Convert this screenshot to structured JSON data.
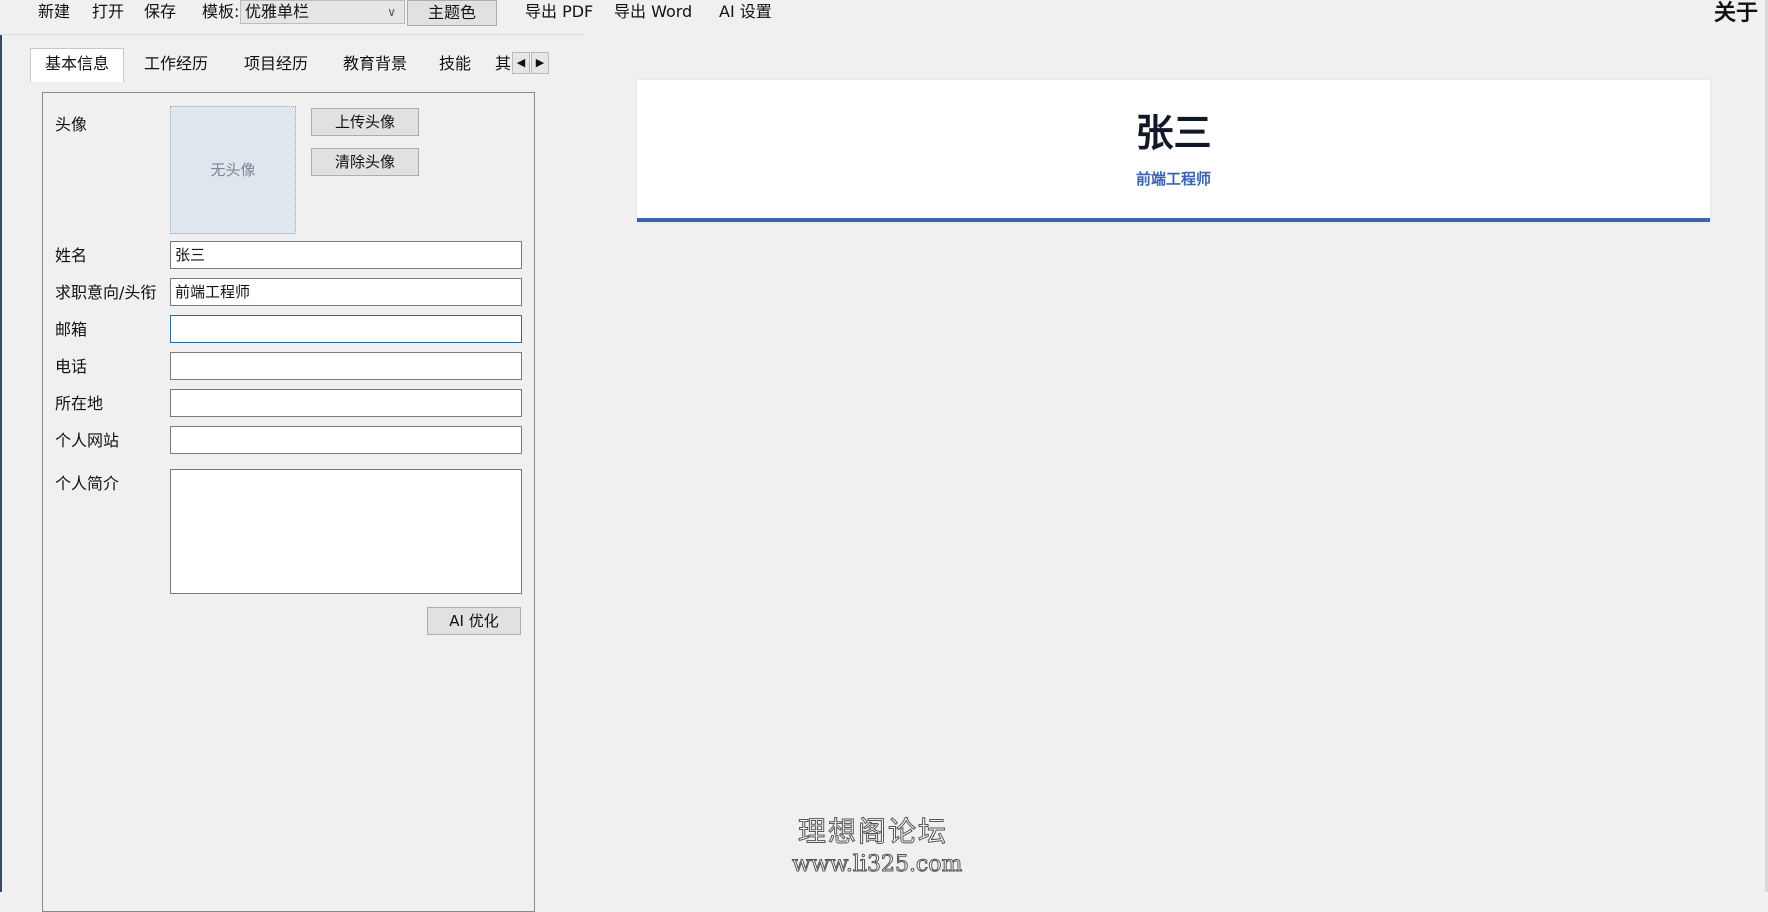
{
  "toolbar": {
    "new_label": "新建",
    "open_label": "打开",
    "save_label": "保存",
    "template_label": "模板:",
    "template_value": "优雅单栏",
    "theme_label": "主题色",
    "export_pdf_label": "导出 PDF",
    "export_word_label": "导出 Word",
    "ai_settings_label": "AI 设置",
    "about_label": "关于"
  },
  "tabs": [
    {
      "label": "基本信息",
      "active": true
    },
    {
      "label": "工作经历"
    },
    {
      "label": "项目经历"
    },
    {
      "label": "教育背景"
    },
    {
      "label": "技能"
    },
    {
      "label": "其"
    }
  ],
  "form": {
    "avatar_label": "头像",
    "no_avatar_text": "无头像",
    "upload_avatar_label": "上传头像",
    "clear_avatar_label": "清除头像",
    "name_label": "姓名",
    "name_value": "张三",
    "title_label": "求职意向/头衔",
    "title_value": "前端工程师",
    "email_label": "邮箱",
    "email_value": "",
    "phone_label": "电话",
    "phone_value": "",
    "location_label": "所在地",
    "location_value": "",
    "website_label": "个人网站",
    "website_value": "",
    "bio_label": "个人简介",
    "bio_value": "",
    "ai_optimize_label": "AI 优化"
  },
  "preview": {
    "name": "张三",
    "title": "前端工程师",
    "accent_color": "#3c64ae"
  },
  "watermark": {
    "line1": "理想阁论坛",
    "line2": "www.li325.com"
  }
}
